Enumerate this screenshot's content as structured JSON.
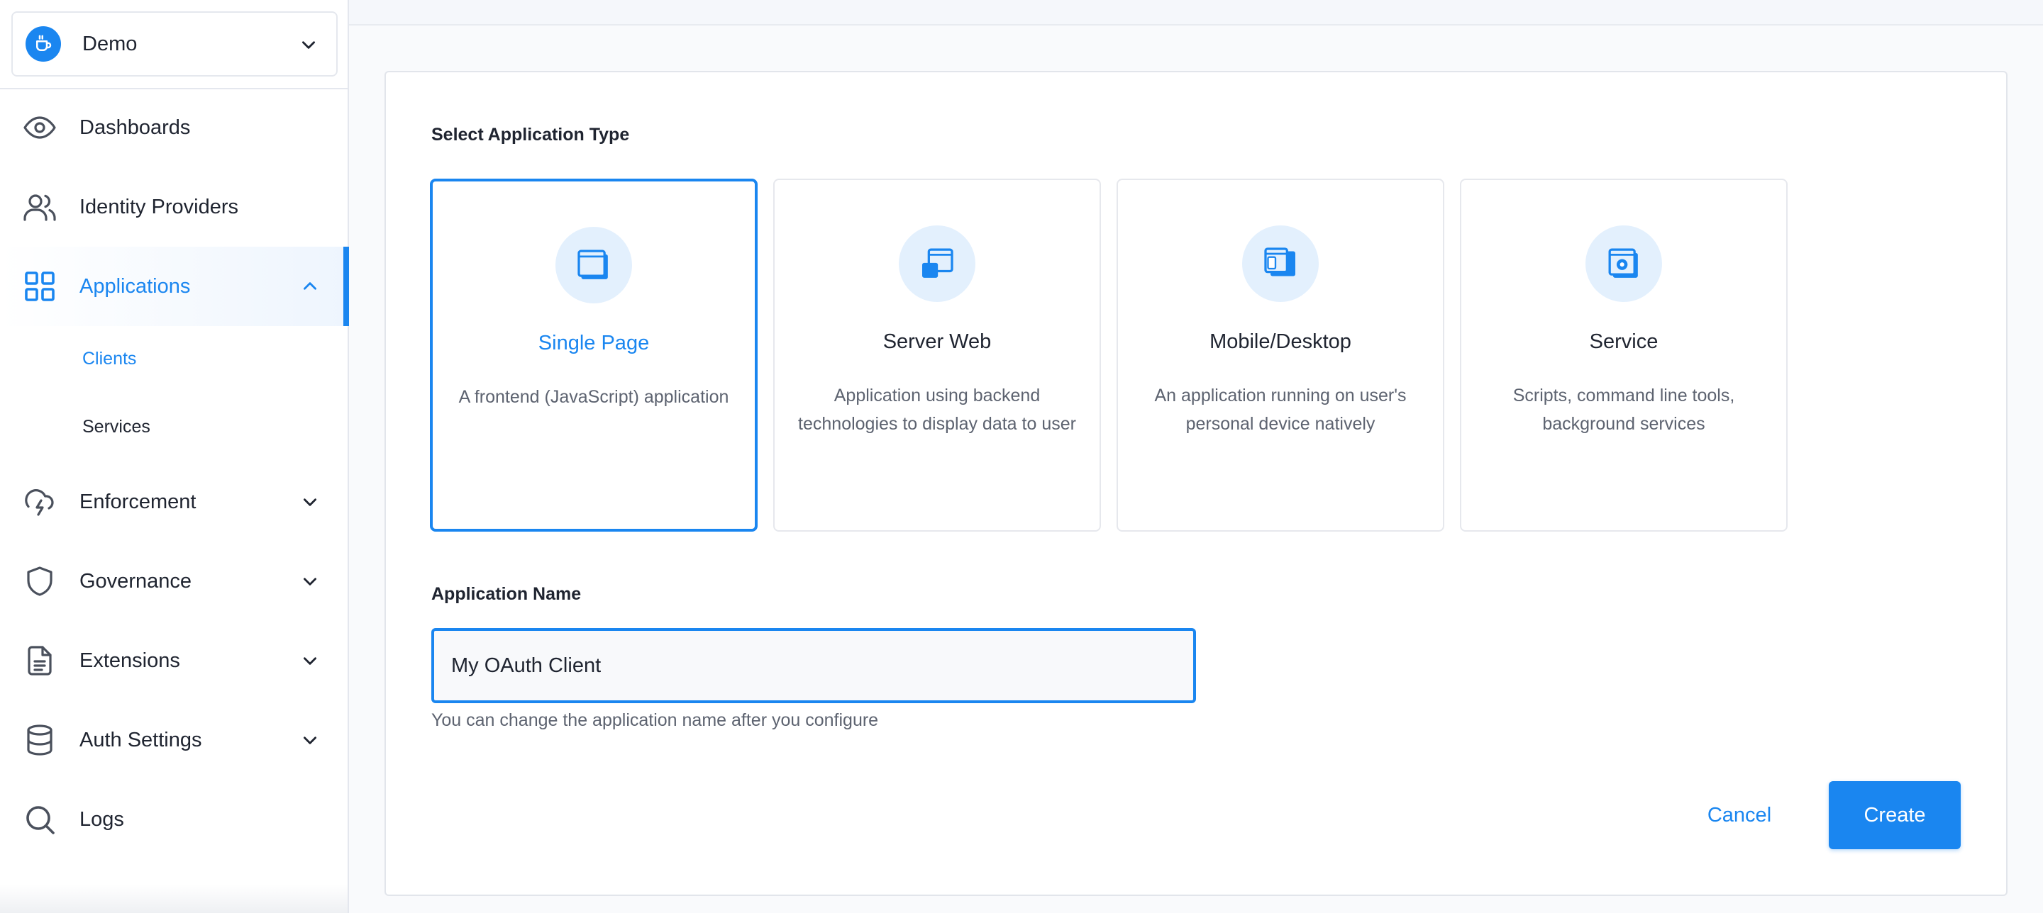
{
  "colors": {
    "accent": "#1a86f0",
    "text": "#1f2430",
    "muted": "#5d6370",
    "icon_bg": "#e3f0fd"
  },
  "tenant": {
    "name": "Demo",
    "logo_icon": "coffee-cup-icon"
  },
  "sidebar": {
    "items": [
      {
        "label": "Dashboards",
        "icon": "eye-icon"
      },
      {
        "label": "Identity Providers",
        "icon": "users-icon"
      },
      {
        "label": "Applications",
        "icon": "grid-icon",
        "active": true,
        "expanded": true
      },
      {
        "label": "Enforcement",
        "icon": "cloud-lightning-icon"
      },
      {
        "label": "Governance",
        "icon": "shield-icon"
      },
      {
        "label": "Extensions",
        "icon": "document-icon"
      },
      {
        "label": "Auth Settings",
        "icon": "database-icon"
      },
      {
        "label": "Logs",
        "icon": "search-icon"
      }
    ],
    "sub_items": [
      {
        "label": "Clients",
        "active": true
      },
      {
        "label": "Services",
        "active": false
      }
    ]
  },
  "form": {
    "type_section_title": "Select Application Type",
    "types": [
      {
        "name": "Single Page",
        "description": "A frontend (JavaScript) application",
        "selected": true
      },
      {
        "name": "Server Web",
        "description": "Application using backend technologies to display data to user",
        "selected": false
      },
      {
        "name": "Mobile/Desktop",
        "description": "An application running on user's personal device natively",
        "selected": false
      },
      {
        "name": "Service",
        "description": "Scripts, command line tools, background services",
        "selected": false
      }
    ],
    "name_section_title": "Application Name",
    "name_value": "My OAuth Client",
    "name_helper": "You can change the application name after you configure",
    "cancel_label": "Cancel",
    "create_label": "Create"
  }
}
